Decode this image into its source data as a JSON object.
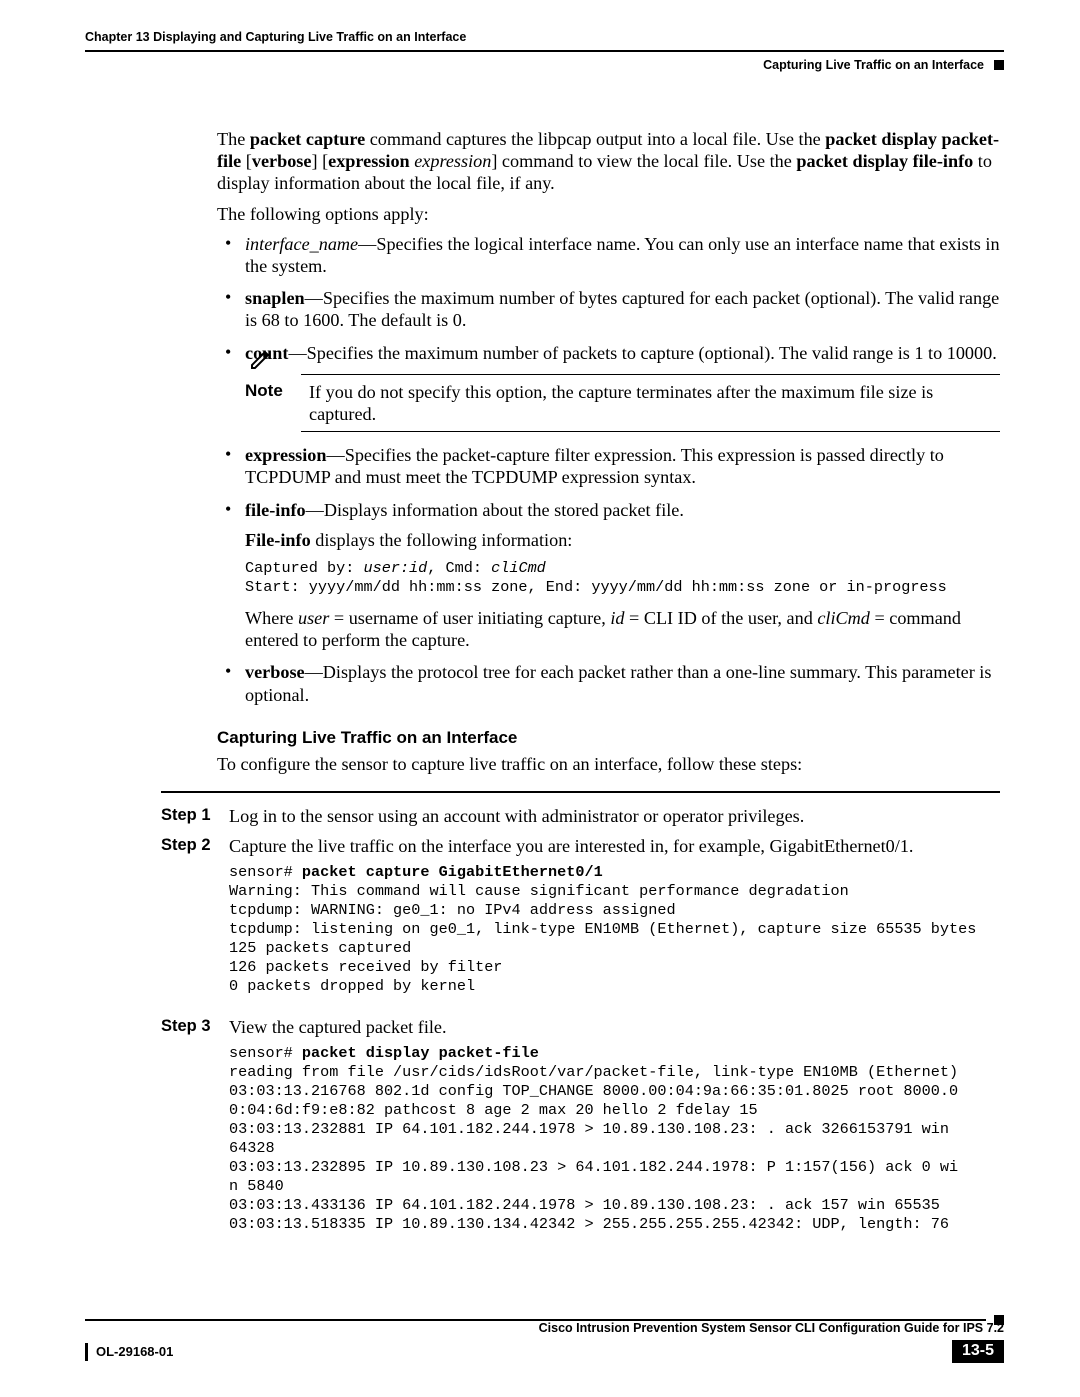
{
  "header": {
    "chapter": "Chapter 13      Displaying and Capturing Live Traffic on an Interface",
    "section": "Capturing Live Traffic on an Interface"
  },
  "intro": {
    "p1_a": "The ",
    "p1_b": "packet capture",
    "p1_c": " command captures the libpcap output into a local file. Use the ",
    "p1_d": "packet display packet-file",
    "p1_e": " [",
    "p1_f": "verbose",
    "p1_g": "] [",
    "p1_h": "expression",
    "p1_i": " ",
    "p1_j": "expression",
    "p1_k": "] command to view the local file. Use the ",
    "p1_l": "packet display file-info",
    "p1_m": " to display information about the local file, if any.",
    "p2": "The following options apply:"
  },
  "opts": {
    "o1_a": "interface_name",
    "o1_b": "—Specifies the logical interface name. You can only use an interface name that exists in the system.",
    "o2_a": "snaplen",
    "o2_b": "—Specifies the maximum number of bytes captured for each packet (optional). The valid range is 68 to 1600. The default is 0.",
    "o3_a": "count",
    "o3_b": "—Specifies the maximum number of packets to capture (optional). The valid range is 1 to 10000.",
    "note_label": "Note",
    "note_text": "If you do not specify this option, the capture terminates after the maximum file size is captured.",
    "o4_a": "expression",
    "o4_b": "—Specifies the packet-capture filter expression. This expression is passed directly to TCPDUMP and must meet the TCPDUMP expression syntax.",
    "o5_a": "file-info",
    "o5_b": "—Displays information about the stored packet file.",
    "o5_c": "File-info",
    "o5_d": " displays the following information:",
    "code1_a": "Captured by: ",
    "code1_b": "user:id",
    "code1_c": ", Cmd: ",
    "code1_d": "cliCmd",
    "code1_line2": "Start: yyyy/mm/dd hh:mm:ss zone, End: yyyy/mm/dd hh:mm:ss zone or in-progress",
    "o5_e_a": "Where ",
    "o5_e_b": "user",
    "o5_e_c": " = username of user initiating capture, ",
    "o5_e_d": "id",
    "o5_e_e": " = CLI ID of the user, and ",
    "o5_e_f": "cliCmd",
    "o5_e_g": " = command entered to perform the capture.",
    "o6_a": "verbose",
    "o6_b": "—Displays the protocol tree for each packet rather than a one-line summary. This parameter is optional."
  },
  "proc": {
    "head": "Capturing Live Traffic on an Interface",
    "intro": "To configure the sensor to capture live traffic on an interface, follow these steps:",
    "s1_label": "Step 1",
    "s1_text": "Log in to the sensor using an account with administrator or operator privileges.",
    "s2_label": "Step 2",
    "s2_text": "Capture the live traffic on the interface you are interested in, for example, GigabitEthernet0/1.",
    "s2_code_prompt": "sensor# ",
    "s2_code_cmd": "packet capture GigabitEthernet0/1",
    "s2_code_rest": "Warning: This command will cause significant performance degradation\ntcpdump: WARNING: ge0_1: no IPv4 address assigned\ntcpdump: listening on ge0_1, link-type EN10MB (Ethernet), capture size 65535 bytes\n125 packets captured\n126 packets received by filter\n0 packets dropped by kernel",
    "s3_label": "Step 3",
    "s3_text": "View the captured packet file.",
    "s3_code_prompt": "sensor# ",
    "s3_code_cmd": "packet display packet-file",
    "s3_code_rest": "reading from file /usr/cids/idsRoot/var/packet-file, link-type EN10MB (Ethernet)\n03:03:13.216768 802.1d config TOP_CHANGE 8000.00:04:9a:66:35:01.8025 root 8000.0\n0:04:6d:f9:e8:82 pathcost 8 age 2 max 20 hello 2 fdelay 15\n03:03:13.232881 IP 64.101.182.244.1978 > 10.89.130.108.23: . ack 3266153791 win\n64328\n03:03:13.232895 IP 10.89.130.108.23 > 64.101.182.244.1978: P 1:157(156) ack 0 wi\nn 5840\n03:03:13.433136 IP 64.101.182.244.1978 > 10.89.130.108.23: . ack 157 win 65535\n03:03:13.518335 IP 10.89.130.134.42342 > 255.255.255.255.42342: UDP, length: 76"
  },
  "footer": {
    "guide": "Cisco Intrusion Prevention System Sensor CLI Configuration Guide for IPS 7.2",
    "docnum": "OL-29168-01",
    "page": "13-5"
  }
}
